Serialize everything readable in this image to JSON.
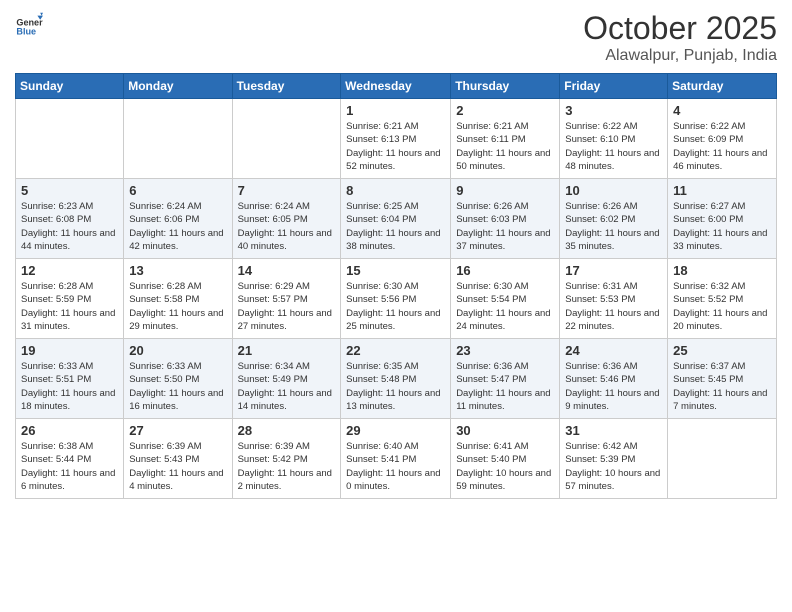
{
  "header": {
    "logo_line1": "General",
    "logo_line2": "Blue",
    "month": "October 2025",
    "location": "Alawalpur, Punjab, India"
  },
  "days_of_week": [
    "Sunday",
    "Monday",
    "Tuesday",
    "Wednesday",
    "Thursday",
    "Friday",
    "Saturday"
  ],
  "weeks": [
    {
      "shaded": false,
      "days": [
        {
          "num": "",
          "info": ""
        },
        {
          "num": "",
          "info": ""
        },
        {
          "num": "",
          "info": ""
        },
        {
          "num": "1",
          "info": "Sunrise: 6:21 AM\nSunset: 6:13 PM\nDaylight: 11 hours\nand 52 minutes."
        },
        {
          "num": "2",
          "info": "Sunrise: 6:21 AM\nSunset: 6:11 PM\nDaylight: 11 hours\nand 50 minutes."
        },
        {
          "num": "3",
          "info": "Sunrise: 6:22 AM\nSunset: 6:10 PM\nDaylight: 11 hours\nand 48 minutes."
        },
        {
          "num": "4",
          "info": "Sunrise: 6:22 AM\nSunset: 6:09 PM\nDaylight: 11 hours\nand 46 minutes."
        }
      ]
    },
    {
      "shaded": true,
      "days": [
        {
          "num": "5",
          "info": "Sunrise: 6:23 AM\nSunset: 6:08 PM\nDaylight: 11 hours\nand 44 minutes."
        },
        {
          "num": "6",
          "info": "Sunrise: 6:24 AM\nSunset: 6:06 PM\nDaylight: 11 hours\nand 42 minutes."
        },
        {
          "num": "7",
          "info": "Sunrise: 6:24 AM\nSunset: 6:05 PM\nDaylight: 11 hours\nand 40 minutes."
        },
        {
          "num": "8",
          "info": "Sunrise: 6:25 AM\nSunset: 6:04 PM\nDaylight: 11 hours\nand 38 minutes."
        },
        {
          "num": "9",
          "info": "Sunrise: 6:26 AM\nSunset: 6:03 PM\nDaylight: 11 hours\nand 37 minutes."
        },
        {
          "num": "10",
          "info": "Sunrise: 6:26 AM\nSunset: 6:02 PM\nDaylight: 11 hours\nand 35 minutes."
        },
        {
          "num": "11",
          "info": "Sunrise: 6:27 AM\nSunset: 6:00 PM\nDaylight: 11 hours\nand 33 minutes."
        }
      ]
    },
    {
      "shaded": false,
      "days": [
        {
          "num": "12",
          "info": "Sunrise: 6:28 AM\nSunset: 5:59 PM\nDaylight: 11 hours\nand 31 minutes."
        },
        {
          "num": "13",
          "info": "Sunrise: 6:28 AM\nSunset: 5:58 PM\nDaylight: 11 hours\nand 29 minutes."
        },
        {
          "num": "14",
          "info": "Sunrise: 6:29 AM\nSunset: 5:57 PM\nDaylight: 11 hours\nand 27 minutes."
        },
        {
          "num": "15",
          "info": "Sunrise: 6:30 AM\nSunset: 5:56 PM\nDaylight: 11 hours\nand 25 minutes."
        },
        {
          "num": "16",
          "info": "Sunrise: 6:30 AM\nSunset: 5:54 PM\nDaylight: 11 hours\nand 24 minutes."
        },
        {
          "num": "17",
          "info": "Sunrise: 6:31 AM\nSunset: 5:53 PM\nDaylight: 11 hours\nand 22 minutes."
        },
        {
          "num": "18",
          "info": "Sunrise: 6:32 AM\nSunset: 5:52 PM\nDaylight: 11 hours\nand 20 minutes."
        }
      ]
    },
    {
      "shaded": true,
      "days": [
        {
          "num": "19",
          "info": "Sunrise: 6:33 AM\nSunset: 5:51 PM\nDaylight: 11 hours\nand 18 minutes."
        },
        {
          "num": "20",
          "info": "Sunrise: 6:33 AM\nSunset: 5:50 PM\nDaylight: 11 hours\nand 16 minutes."
        },
        {
          "num": "21",
          "info": "Sunrise: 6:34 AM\nSunset: 5:49 PM\nDaylight: 11 hours\nand 14 minutes."
        },
        {
          "num": "22",
          "info": "Sunrise: 6:35 AM\nSunset: 5:48 PM\nDaylight: 11 hours\nand 13 minutes."
        },
        {
          "num": "23",
          "info": "Sunrise: 6:36 AM\nSunset: 5:47 PM\nDaylight: 11 hours\nand 11 minutes."
        },
        {
          "num": "24",
          "info": "Sunrise: 6:36 AM\nSunset: 5:46 PM\nDaylight: 11 hours\nand 9 minutes."
        },
        {
          "num": "25",
          "info": "Sunrise: 6:37 AM\nSunset: 5:45 PM\nDaylight: 11 hours\nand 7 minutes."
        }
      ]
    },
    {
      "shaded": false,
      "days": [
        {
          "num": "26",
          "info": "Sunrise: 6:38 AM\nSunset: 5:44 PM\nDaylight: 11 hours\nand 6 minutes."
        },
        {
          "num": "27",
          "info": "Sunrise: 6:39 AM\nSunset: 5:43 PM\nDaylight: 11 hours\nand 4 minutes."
        },
        {
          "num": "28",
          "info": "Sunrise: 6:39 AM\nSunset: 5:42 PM\nDaylight: 11 hours\nand 2 minutes."
        },
        {
          "num": "29",
          "info": "Sunrise: 6:40 AM\nSunset: 5:41 PM\nDaylight: 11 hours\nand 0 minutes."
        },
        {
          "num": "30",
          "info": "Sunrise: 6:41 AM\nSunset: 5:40 PM\nDaylight: 10 hours\nand 59 minutes."
        },
        {
          "num": "31",
          "info": "Sunrise: 6:42 AM\nSunset: 5:39 PM\nDaylight: 10 hours\nand 57 minutes."
        },
        {
          "num": "",
          "info": ""
        }
      ]
    }
  ]
}
